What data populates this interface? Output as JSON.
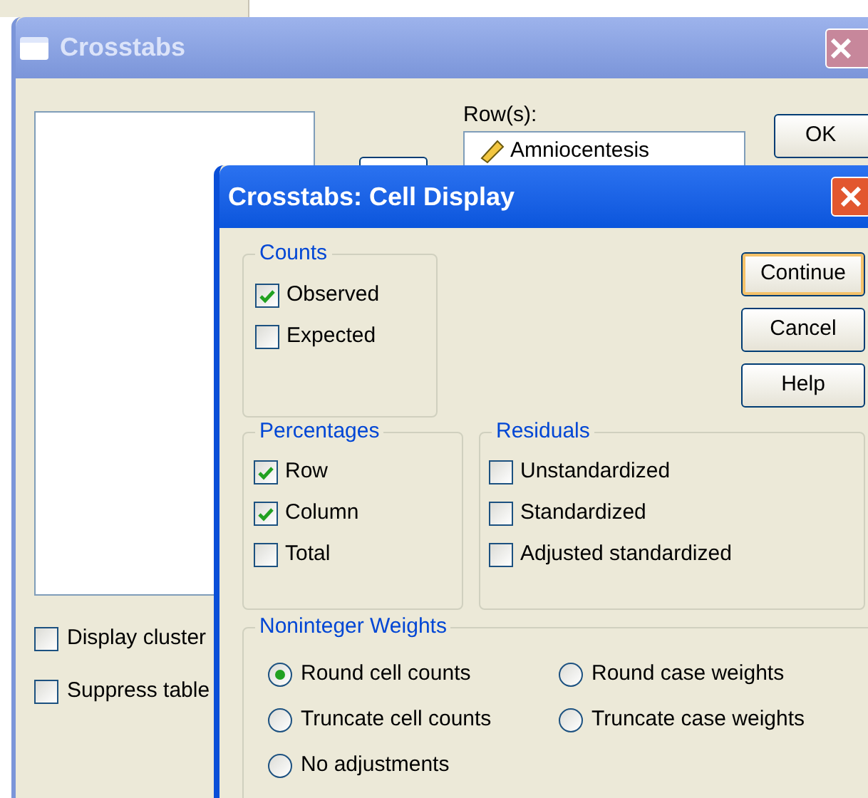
{
  "main_window": {
    "title": "Crosstabs",
    "row_label": "Row(s):",
    "row_items": [
      "Amniocentesis"
    ],
    "buttons": [
      "OK"
    ],
    "options": [
      {
        "label": "Display cluster",
        "checked": false
      },
      {
        "label": "Suppress table",
        "checked": false
      }
    ]
  },
  "dialog": {
    "title": "Crosstabs: Cell Display",
    "counts": {
      "title": "Counts",
      "items": [
        {
          "label": "Observed",
          "checked": true
        },
        {
          "label": "Expected",
          "checked": false
        }
      ]
    },
    "buttons": [
      {
        "label": "Continue",
        "default": true
      },
      {
        "label": "Cancel",
        "default": false
      },
      {
        "label": "Help",
        "default": false
      }
    ],
    "percentages": {
      "title": "Percentages",
      "items": [
        {
          "label": "Row",
          "checked": true
        },
        {
          "label": "Column",
          "checked": true
        },
        {
          "label": "Total",
          "checked": false
        }
      ]
    },
    "residuals": {
      "title": "Residuals",
      "items": [
        {
          "label": "Unstandardized",
          "checked": false
        },
        {
          "label": "Standardized",
          "checked": false
        },
        {
          "label": "Adjusted standardized",
          "checked": false
        }
      ]
    },
    "noninteger_weights": {
      "title": "Noninteger Weights",
      "items": [
        {
          "label": "Round cell counts",
          "selected": true
        },
        {
          "label": "Round case weights",
          "selected": false
        },
        {
          "label": "Truncate cell counts",
          "selected": false
        },
        {
          "label": "Truncate case weights",
          "selected": false
        },
        {
          "label": "No adjustments",
          "selected": false
        }
      ]
    }
  }
}
